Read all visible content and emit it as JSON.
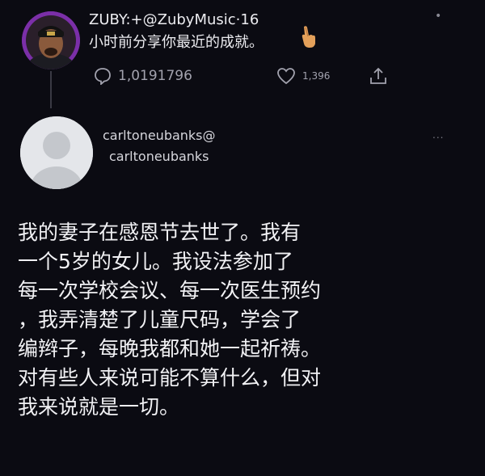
{
  "top_tweet": {
    "header_line": "ZUBY:+@ZubyMusic·16",
    "text": "小时前分享你最近的成就。",
    "more_label": "•",
    "reply_count": "1,0191796",
    "like_count": "1,396",
    "icons": {
      "avatar": "profile-photo",
      "pointer": "pointing-finger-icon",
      "reply": "speech-bubble-icon",
      "like": "heart-icon",
      "share": "share-icon"
    }
  },
  "reply_tweet": {
    "display_name": "carltoneubanks@",
    "handle": "carltoneubanks",
    "more_label": "...",
    "body_lines": [
      "我的妻子在感恩节去世了。我有",
      "一个5岁的女儿。我设法参加了",
      "每一次学校会议、每一次医生预约",
      "，我弄清楚了儿童尺码，学会了",
      "编辫子，每晚我都和她一起祈祷。",
      "对有些人来说可能不算什么，但对",
      "我来说就是一切。"
    ]
  },
  "colors": {
    "background": "#0b0b12",
    "avatar_ring": "#7b2fa8",
    "text": "#ececf0",
    "muted": "#9a9aa6"
  }
}
